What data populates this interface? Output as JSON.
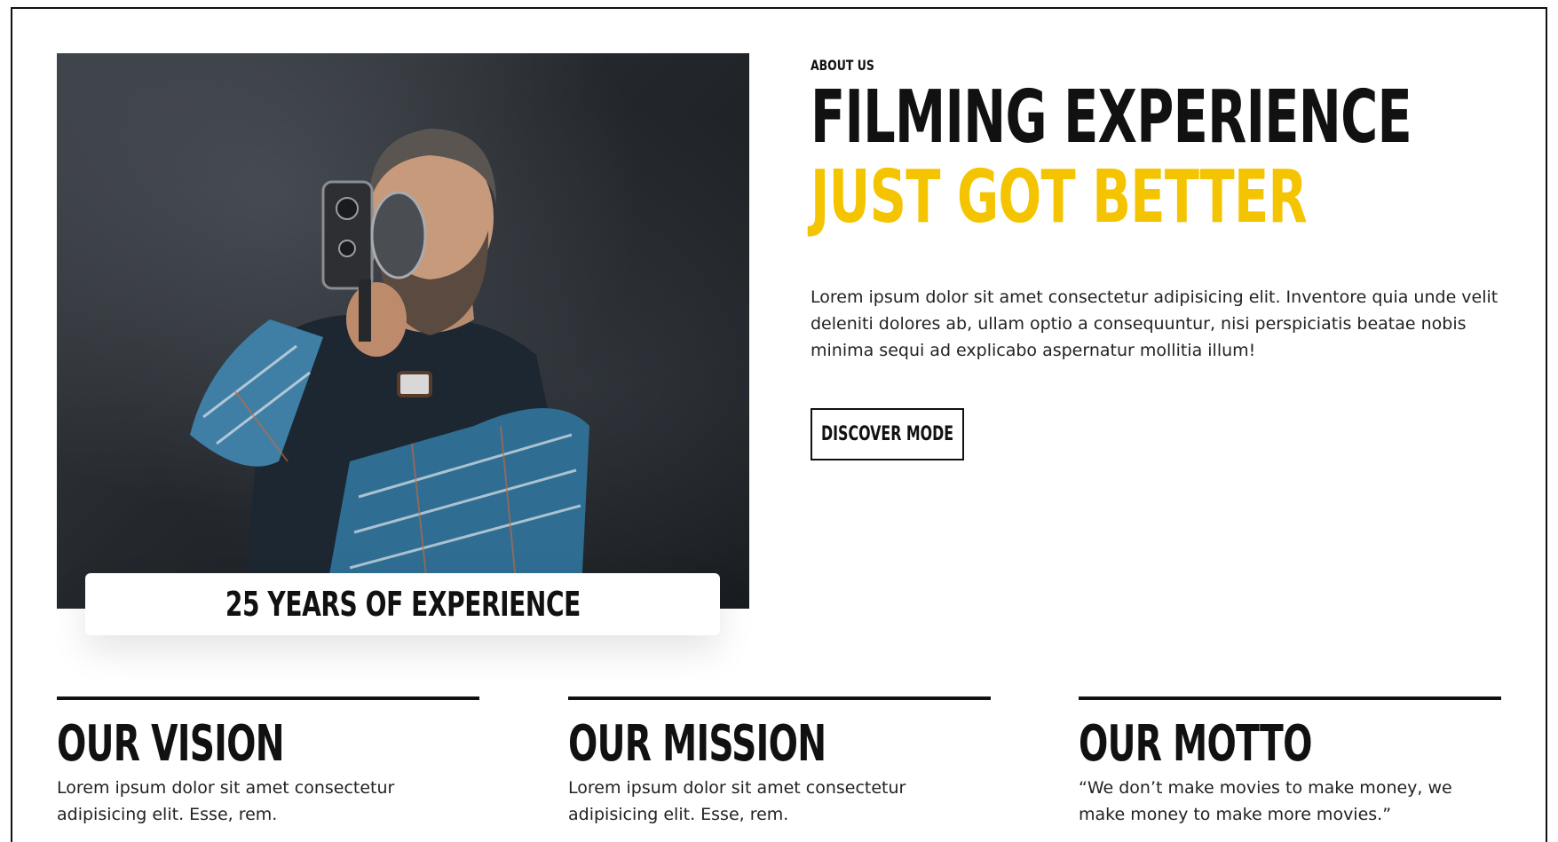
{
  "about": {
    "eyebrow": "ABOUT US",
    "headline_line1": "FILMING EXPERIENCE",
    "headline_line2": "JUST GOT BETTER",
    "body": "Lorem ipsum dolor sit amet consectetur adipisicing elit. Inventore quia unde velit deleniti dolores ab, ullam optio a consequuntur, nisi perspiciatis beatae nobis minima sequi ad explicabo aspernatur mollitia illum!",
    "cta_label": "DISCOVER MODE"
  },
  "photo": {
    "badge_text": "25 YEARS OF EXPERIENCE"
  },
  "cards": [
    {
      "title": "OUR VISION",
      "text": "Lorem ipsum dolor sit amet consectetur adipisicing elit. Esse, rem."
    },
    {
      "title": "OUR MISSION",
      "text": "Lorem ipsum dolor sit amet consectetur adipisicing elit. Esse, rem."
    },
    {
      "title": "OUR MOTTO",
      "text": "“We don’t make movies to make money, we make money to make more movies.”"
    }
  ],
  "colors": {
    "accent": "#f5c400",
    "text": "#111111"
  }
}
